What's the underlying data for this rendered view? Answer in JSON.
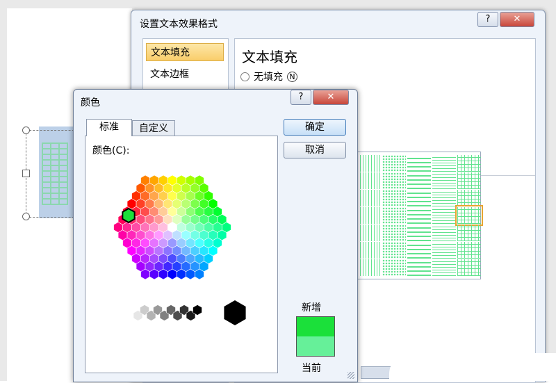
{
  "format_dialog": {
    "title": "设置文本效果格式",
    "help_label": "?",
    "close_label": "✕",
    "nav_items": [
      {
        "label": "文本填充",
        "selected": true
      },
      {
        "label": "文本边框",
        "selected": false
      }
    ],
    "section_title": "文本填充",
    "fill_options": [
      {
        "label": "无填充",
        "shortcut": "N"
      }
    ],
    "selected_pattern_index": 19,
    "pattern_color": "#61e38e"
  },
  "color_dialog": {
    "title": "颜色",
    "help_label": "?",
    "close_label": "✕",
    "tabs": [
      {
        "label": "标准",
        "active": true
      },
      {
        "label": "自定义",
        "active": false
      }
    ],
    "colors_label": "颜色(C):",
    "ok_label": "确定",
    "cancel_label": "取消",
    "new_label": "新增",
    "current_label": "当前",
    "new_color": "#1be03a",
    "current_color": "#66f099",
    "selected_swatch_color": "#1be03a"
  }
}
